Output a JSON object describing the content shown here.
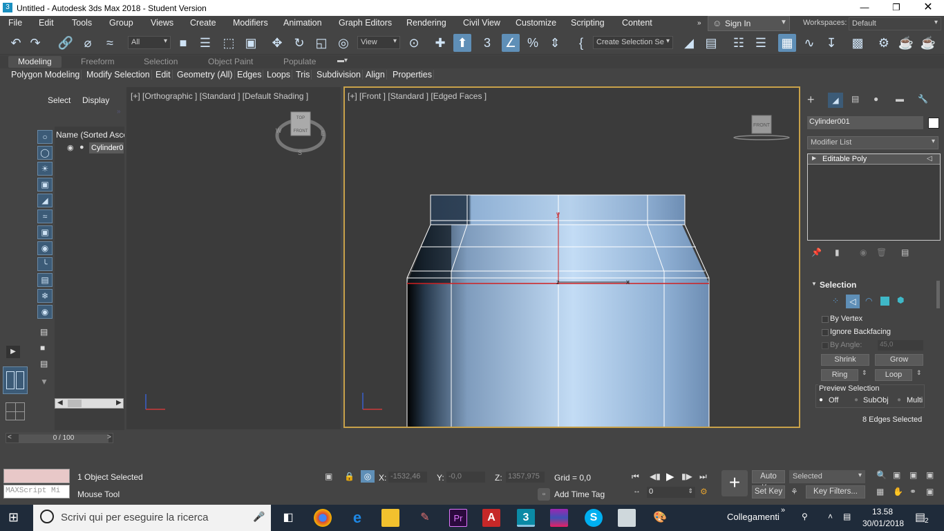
{
  "window": {
    "title": "Untitled - Autodesk 3ds Max 2018 - Student Version",
    "app_icon": "3"
  },
  "menu": {
    "items": [
      "File",
      "Edit",
      "Tools",
      "Group",
      "Views",
      "Create",
      "Modifiers",
      "Animation",
      "Graph Editors",
      "Rendering",
      "Civil View",
      "Customize",
      "Scripting",
      "Content"
    ],
    "sign_in": "Sign In",
    "workspaces_label": "Workspaces:",
    "workspace_value": "Default"
  },
  "toolbar": {
    "filter_value": "All",
    "ref_coord_value": "View",
    "selection_set_value": "Create Selection Se"
  },
  "ribbon": {
    "tabs": [
      "Modeling",
      "Freeform",
      "Selection",
      "Object Paint",
      "Populate"
    ],
    "buttons": [
      "Polygon Modeling",
      "Modify Selection",
      "Edit",
      "Geometry (All)",
      "Edges",
      "Loops",
      "Tris",
      "Subdivision",
      "Align",
      "Properties"
    ]
  },
  "scene_explorer": {
    "tab_select": "Select",
    "tab_display": "Display",
    "column_header": "Name (Sorted Ascen",
    "item": "Cylinder00"
  },
  "viewports": {
    "left_label": "[+] [Orthographic ] [Standard ] [Default Shading ]",
    "right_label": "[+] [Front ] [Standard ] [Edged Faces ]",
    "viewcube_left_face": "FRONT",
    "viewcube_left_top": "TOP",
    "compass": {
      "w": "W",
      "e": "E",
      "s": "S"
    },
    "viewcube_right_face": "FRONT",
    "gizmo": {
      "x": "x",
      "y": "y",
      "z": "z"
    }
  },
  "command_panel": {
    "object_name": "Cylinder001",
    "modifier_list": "Modifier List",
    "stack_item": "Editable Poly",
    "rollout_title": "Selection",
    "by_vertex": "By Vertex",
    "ignore_backfacing": "Ignore Backfacing",
    "by_angle": "By Angle:",
    "by_angle_value": "45,0",
    "shrink": "Shrink",
    "grow": "Grow",
    "ring": "Ring",
    "loop": "Loop",
    "preview_selection": "Preview Selection",
    "preview_options": [
      "Off",
      "SubObj",
      "Multi"
    ],
    "status": "8 Edges Selected"
  },
  "timeline": {
    "frame_display": "0 / 100"
  },
  "status": {
    "maxscript_placeholder": "MAXScript Mi",
    "objects_selected": "1 Object Selected",
    "prompt": "Mouse Tool",
    "x_label": "X:",
    "x_value": "-1532,46",
    "y_label": "Y:",
    "y_value": "-0,0",
    "z_label": "Z:",
    "z_value": "1357,975",
    "grid": "Grid = 0,0",
    "add_time_tag": "Add Time Tag",
    "auto_key": "Auto Key",
    "set_key": "Set Key",
    "key_mode_value": "Selected",
    "key_filters": "Key Filters...",
    "frame_value": "0"
  },
  "taskbar": {
    "search_placeholder": "Scrivi qui per eseguire la ricerca",
    "tray_label": "Collegamenti",
    "time": "13.58",
    "date": "30/01/2018",
    "notification_count": "2"
  },
  "colors": {
    "accent": "#5f8fb7",
    "viewport_border": "#c9a24a",
    "selected_edge": "#d02020"
  }
}
